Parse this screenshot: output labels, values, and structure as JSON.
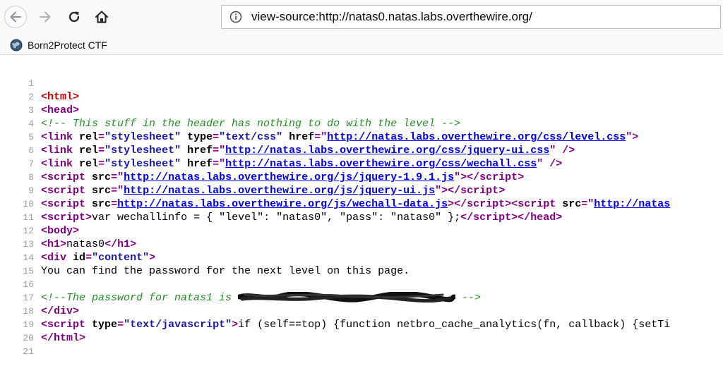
{
  "toolbar": {
    "url": "view-source:http://natas0.natas.labs.overthewire.org/"
  },
  "bookmarks": [
    {
      "label": "Born2Protect CTF"
    }
  ],
  "source": {
    "line_numbers": [
      "1",
      "2",
      "3",
      "4",
      "5",
      "6",
      "7",
      "8",
      "9",
      "10",
      "11",
      "12",
      "13",
      "14",
      "15",
      "16",
      "17",
      "18",
      "19",
      "20",
      "21"
    ],
    "t_html": "html",
    "t_head": "head",
    "comment_header": "<!-- This stuff in the header has nothing to do with the level -->",
    "t_link": "link",
    "a_rel": "rel",
    "a_type": "type",
    "a_href": "href",
    "a_src": "src",
    "a_id": "id",
    "v_stylesheet": "\"stylesheet\"",
    "v_textcss": "\"text/css\"",
    "v_textjs": "\"text/javascript\"",
    "v_content": "\"content\"",
    "href_level_css": "http://natas.labs.overthewire.org/css/level.css",
    "href_jqueryui_css": "http://natas.labs.overthewire.org/css/jquery-ui.css",
    "href_wechall_css": "http://natas.labs.overthewire.org/css/wechall.css",
    "src_jquery": "http://natas.labs.overthewire.org/js/jquery-1.9.1.js",
    "src_jqueryui": "http://natas.labs.overthewire.org/js/jquery-ui.js",
    "src_wechall_data": "http://natas.labs.overthewire.org/js/wechall-data.js",
    "src_natas_trunc": "http://natas",
    "t_script": "script",
    "line10_text": "var wechallinfo = { \"level\": \"natas0\", \"pass\": \"natas0\" };",
    "t_body": "body",
    "t_h1": "h1",
    "h1_text": "natas0",
    "t_div": "div",
    "line14_text": "You can find the password for the next level on this page.",
    "comment_pw_prefix": "<!--The password for natas1 is ",
    "comment_pw_suffix": " -->",
    "line18_text": "if (self==top) {function netbro_cache_analytics(fn, callback) {setTi"
  }
}
